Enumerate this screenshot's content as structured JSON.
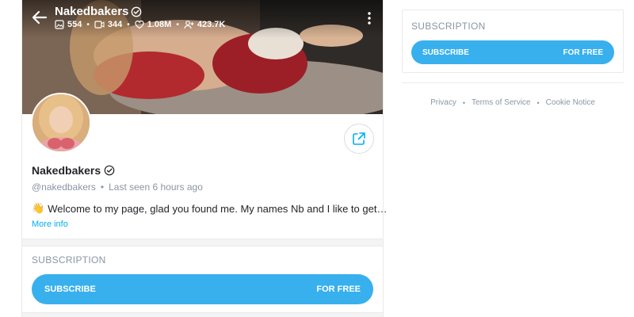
{
  "header": {
    "name": "Nakedbakers",
    "stats": {
      "photos": "554",
      "videos": "344",
      "likes": "1.08M",
      "fans": "423.7K"
    }
  },
  "profile": {
    "name": "Nakedbakers",
    "handle": "@nakedbakers",
    "separator": "•",
    "last_seen": "Last seen 6 hours ago",
    "bio_emoji": "👋",
    "bio": "Welcome to my page, glad you found me. My names Nb and I like to get…",
    "more_info": "More info"
  },
  "subscription_left": {
    "title": "SUBSCRIPTION",
    "button_label": "SUBSCRIBE",
    "button_price": "FOR FREE"
  },
  "subscription_right": {
    "title": "SUBSCRIPTION",
    "button_label": "SUBSCRIBE",
    "button_price": "FOR FREE"
  },
  "footer": {
    "links": [
      "Privacy",
      "Terms of Service",
      "Cookie Notice"
    ],
    "separator": "•"
  },
  "icons": {
    "back": "arrow-left-icon",
    "verified": "verified-badge-icon",
    "photos": "image-icon",
    "videos": "video-icon",
    "likes": "heart-icon",
    "fans": "user-plus-icon",
    "menu": "kebab-menu-icon",
    "share": "share-icon"
  },
  "colors": {
    "accent": "#38b0ed",
    "link": "#00aff0",
    "muted": "#8a96a3",
    "text": "#242529"
  }
}
